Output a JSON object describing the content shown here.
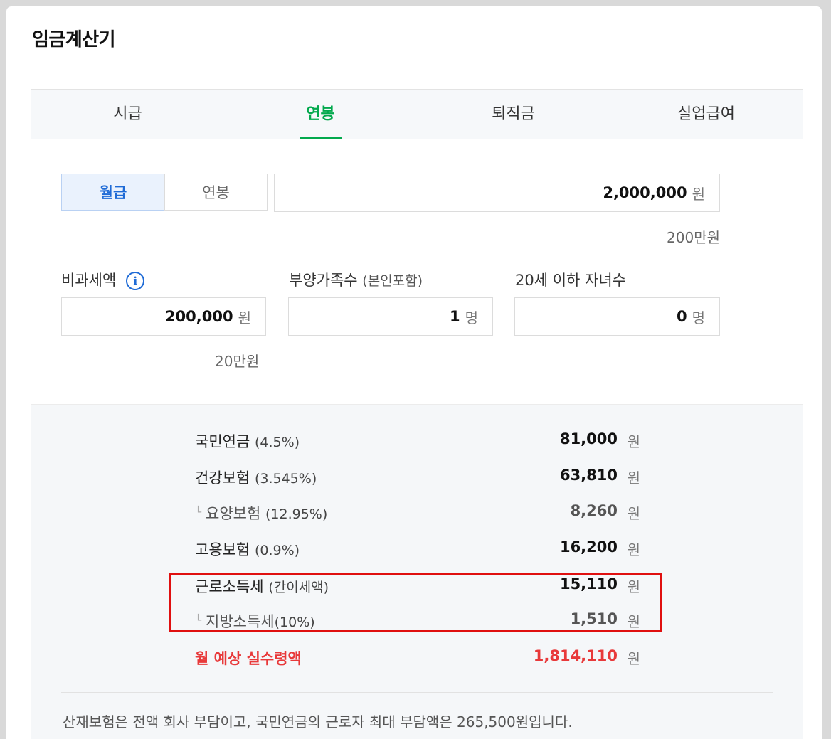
{
  "app": {
    "title": "임금계산기"
  },
  "tabs": [
    {
      "label": "시급",
      "active": false
    },
    {
      "label": "연봉",
      "active": true
    },
    {
      "label": "퇴직금",
      "active": false
    },
    {
      "label": "실업급여",
      "active": false
    }
  ],
  "salary": {
    "mode_options": [
      "월급",
      "연봉"
    ],
    "selected_mode": "월급",
    "amount": "2,000,000",
    "unit": "원",
    "amount_hint": "200만원"
  },
  "fields": {
    "nontax": {
      "label": "비과세액",
      "value": "200,000",
      "unit": "원",
      "hint": "20만원"
    },
    "dependents": {
      "label": "부양가족수",
      "sublabel": "(본인포함)",
      "value": "1",
      "unit": "명"
    },
    "children": {
      "label": "20세 이하 자녀수",
      "value": "0",
      "unit": "명"
    }
  },
  "results": [
    {
      "label": "국민연금",
      "pct": "(4.5%)",
      "amount": "81,000",
      "unit": "원"
    },
    {
      "label": "건강보험",
      "pct": "(3.545%)",
      "amount": "63,810",
      "unit": "원"
    },
    {
      "label": "요양보험",
      "pct": "(12.95%)",
      "amount": "8,260",
      "unit": "원"
    },
    {
      "label": "고용보험",
      "pct": "(0.9%)",
      "amount": "16,200",
      "unit": "원"
    },
    {
      "label": "근로소득세",
      "pct": "(간이세액)",
      "amount": "15,110",
      "unit": "원"
    },
    {
      "label": "지방소득세",
      "pct": "(10%)",
      "amount": "1,510",
      "unit": "원"
    },
    {
      "label": "월 예상 실수령액",
      "pct": "",
      "amount": "1,814,110",
      "unit": "원"
    }
  ],
  "note": "산재보험은 전액 회사 부담이고, 국민연금의 근로자 최대 부담액은 265,500원입니다.",
  "colors": {
    "accent": "#03a94d",
    "selected": "#1f6bd6",
    "net": "#e8393a",
    "highlight": "#e01010"
  },
  "icons": {
    "info": "i"
  }
}
